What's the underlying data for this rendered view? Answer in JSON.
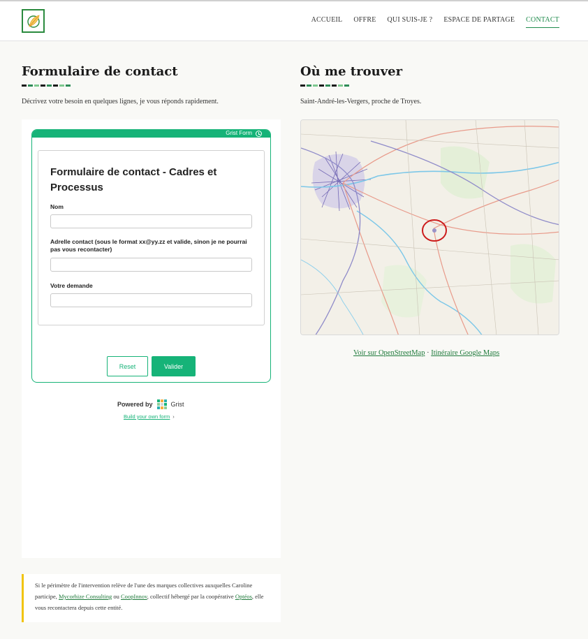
{
  "nav": {
    "items": [
      {
        "label": "ACCUEIL",
        "active": false
      },
      {
        "label": "OFFRE",
        "active": false
      },
      {
        "label": "QUI SUIS-JE ?",
        "active": false
      },
      {
        "label": "ESPACE DE PARTAGE",
        "active": false
      },
      {
        "label": "CONTACT",
        "active": true
      }
    ]
  },
  "contact": {
    "heading": "Formulaire de contact",
    "lead": "Décrivez votre besoin en quelques lignes, je vous réponds rapidement.",
    "grist_bar_label": "Grist Form",
    "form_title": "Formulaire de contact - Cadres et Processus",
    "fields": [
      {
        "label": "Nom",
        "value": ""
      },
      {
        "label": "Adrelle contact (sous le format xx@yy.zz et valide, sinon je ne pourrai pas vous recontacter)",
        "value": ""
      },
      {
        "label": "Votre demande",
        "value": ""
      }
    ],
    "reset_label": "Reset",
    "submit_label": "Valider",
    "powered_by": "Powered by",
    "grist_brand": "Grist",
    "build_link": "Build your own form"
  },
  "location": {
    "heading": "Où me trouver",
    "lead": "Saint-André-les-Vergers, proche de Troyes.",
    "link_osm": "Voir sur OpenStreetMap",
    "separator": " · ",
    "link_gmaps": "Itinéraire Google Maps"
  },
  "note": {
    "text_1": "Si le périmètre de l'intervention relève de l'une des marques collectives auxquelles Caroline participe, ",
    "link_1": "Mycorhize Consulting",
    "text_2": " ou ",
    "link_2": "CoopInnov",
    "text_3": ", collectif hébergé par la coopérative ",
    "link_3": "Optéos",
    "text_4": ", elle vous recontactera depuis cette entité."
  },
  "colors": {
    "accent": "#16b378",
    "nav_active": "#1f8b4c",
    "note_border": "#f1c40f",
    "deco": [
      "#1a1a1a",
      "#2e8b57",
      "#7dc98f",
      "#1a1a1a",
      "#2e8b57",
      "#1a1a1a",
      "#7dc98f",
      "#2e8b57"
    ]
  },
  "icons": {
    "logo": "leaf-circle-logo",
    "grist_bar": "grist-circle-icon",
    "chevron": "chevron-right-icon"
  }
}
